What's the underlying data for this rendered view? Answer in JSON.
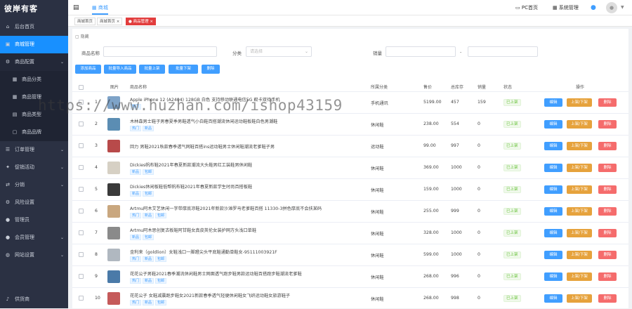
{
  "app": {
    "logo": "彼岸有客"
  },
  "sidebar": {
    "items": [
      {
        "icon": "home-icon",
        "label": "后台首页"
      },
      {
        "icon": "shop-icon",
        "label": "商城管理"
      },
      {
        "icon": "gear-icon",
        "label": "商品配置"
      },
      {
        "icon": "grid-icon",
        "label": "商品分类"
      },
      {
        "icon": "grid-icon",
        "label": "商品管理"
      },
      {
        "icon": "doc-icon",
        "label": "商品类型"
      },
      {
        "icon": "bag-icon",
        "label": "商品品牌"
      },
      {
        "icon": "list-icon",
        "label": "订单管理"
      },
      {
        "icon": "gift-icon",
        "label": "促销活动"
      },
      {
        "icon": "share-icon",
        "label": "分销"
      },
      {
        "icon": "gear-icon",
        "label": "风险设置"
      },
      {
        "icon": "user-icon",
        "label": "管理员"
      },
      {
        "icon": "user-icon",
        "label": "会员管理"
      },
      {
        "icon": "globe-icon",
        "label": "网站设置"
      },
      {
        "icon": "bell-icon",
        "label": "供货商"
      }
    ]
  },
  "topbar": {
    "collapse_icon": "menu-fold-icon",
    "nav_label": "商城",
    "pc_home": "PC首页",
    "system": "系统管理"
  },
  "tabs": [
    {
      "label": "商城首页"
    },
    {
      "label": "商城首页"
    },
    {
      "label": "商品管理"
    }
  ],
  "filters": {
    "toggle": "隐藏",
    "name_label": "商品名称",
    "category_label": "分类",
    "category_placeholder": "请选择",
    "stock_label": "销量",
    "range_sep": "-"
  },
  "toolbar": {
    "add": "添加商品",
    "batch_import": "批量导入商品",
    "batch_on": "批量上架",
    "batch_off": "批量下架",
    "delete": "删除"
  },
  "columns": {
    "img": "图片",
    "name": "商品名称",
    "category": "所属分类",
    "price": "售价",
    "stock": "总库存",
    "sales": "销量",
    "status": "状态",
    "ops": "操作"
  },
  "actions": {
    "edit": "编辑",
    "toggle": "上架/下架",
    "delete": "删除"
  },
  "rows": [
    {
      "id": "1",
      "name": "Apple iPhone 12 (A2404) 128GB 白色 支持移动联通电信5G 双卡双待手机",
      "tags": [
        "热门"
      ],
      "category": "手机通讯",
      "price": "5199.00",
      "stock": "457",
      "sales": "159",
      "status": "已上架",
      "thumb": "#7ea3c8"
    },
    {
      "id": "2",
      "name": "木林森男士鞋子男春夏季男鞋透气小白鞋百搭潮流休闲运动鞋板鞋白色男潮鞋",
      "tags": [
        "热门",
        "新品"
      ],
      "category": "休闲鞋",
      "price": "238.00",
      "stock": "554",
      "sales": "0",
      "status": "已上架",
      "thumb": "#5b8db3"
    },
    {
      "id": "3",
      "name": "回力 男鞋2021秋款春季透气网鞋百搭ins运动鞋男士休闲鞋潮流老爹鞋子男",
      "tags": [],
      "category": "运动鞋",
      "price": "99.00",
      "stock": "997",
      "sales": "0",
      "status": "已上架",
      "thumb": "#b84a4a"
    },
    {
      "id": "4",
      "name": "Dickies帆布鞋2021年春夏新款潮流大头鞋男红工装鞋男休闲鞋",
      "tags": [
        "新品",
        "包邮"
      ],
      "category": "休闲鞋",
      "price": "369.00",
      "stock": "1000",
      "sales": "0",
      "status": "已上架",
      "thumb": "#d6d0c4"
    },
    {
      "id": "5",
      "name": "Dickies休闲板鞋低帮帆布鞋2021年春夏新款学生时尚百搭板鞋",
      "tags": [
        "新品",
        "包邮"
      ],
      "category": "休闲鞋",
      "price": "159.00",
      "stock": "1000",
      "sales": "0",
      "status": "已上架",
      "thumb": "#3a3a3a"
    },
    {
      "id": "6",
      "name": "Artmu阿木艾艺休闲一字带厚底凉鞋2021年新款沙滩罗马老爹鞋百搭 11330-3拼色厚底不会扶某码",
      "tags": [
        "热门",
        "新品",
        "包邮"
      ],
      "category": "休闲鞋",
      "price": "255.00",
      "stock": "999",
      "sales": "0",
      "status": "已上架",
      "thumb": "#c9a77f"
    },
    {
      "id": "7",
      "name": "Artmu阿木思创复古板鞋阿甘鞋女真皮英伦女装护网方头浅口单鞋",
      "tags": [
        "新品",
        "包邮"
      ],
      "category": "休闲鞋",
      "price": "328.00",
      "stock": "1000",
      "sales": "0",
      "status": "已上架",
      "thumb": "#8a8a8a"
    },
    {
      "id": "8",
      "name": "金利来（goldlion）女鞋浅口一脚蹬尖头平底鞋通勤单鞋女-95111003921F",
      "tags": [
        "热门",
        "新品",
        "包邮"
      ],
      "category": "休闲鞋",
      "price": "599.00",
      "stock": "1000",
      "sales": "0",
      "status": "已上架",
      "thumb": "#b0b8c0"
    },
    {
      "id": "9",
      "name": "花花公子男鞋2021春季潮流休闲鞋男士网面透气跑步鞋男款运动鞋百搭跑步鞋潮流老爹鞋",
      "tags": [
        "热门",
        "新品",
        "包邮"
      ],
      "category": "休闲鞋",
      "price": "268.00",
      "stock": "996",
      "sales": "0",
      "status": "已上架",
      "thumb": "#4a7aa8"
    },
    {
      "id": "10",
      "name": "花花公子 女鞋减震跑步鞋女2021新款春季透气轻便休闲鞋女飞织运动鞋女旅游鞋子",
      "tags": [
        "热门",
        "新品",
        "包邮"
      ],
      "category": "休闲鞋",
      "price": "268.00",
      "stock": "998",
      "sales": "0",
      "status": "已上架",
      "thumb": "#c55a5a"
    }
  ],
  "watermark": "https://www.huzhan.com/ishop43159"
}
